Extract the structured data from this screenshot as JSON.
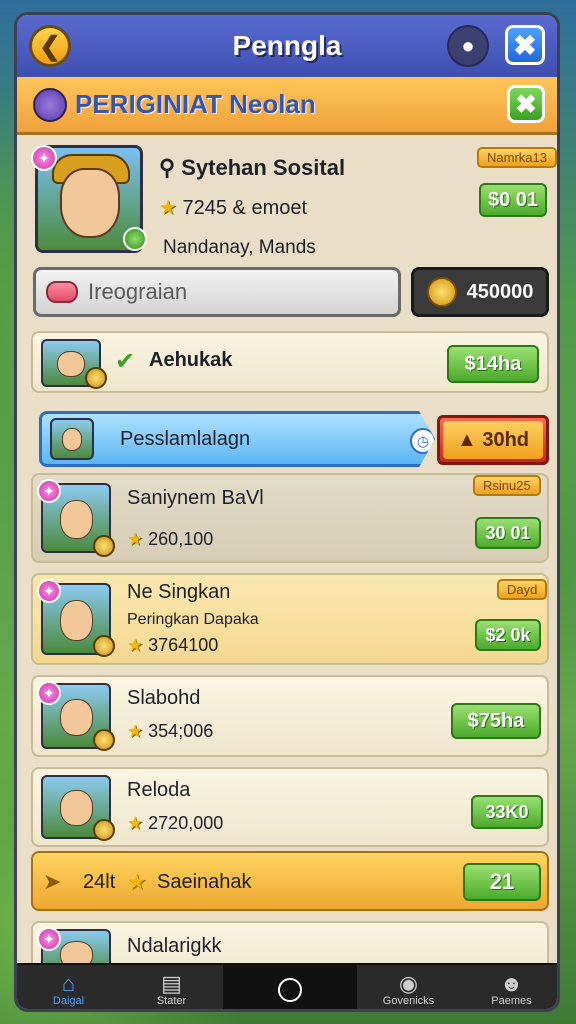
{
  "header": {
    "title": "Penngla",
    "back_icon": "chevron-left-icon",
    "close_icon": "close-icon"
  },
  "banner": {
    "title": "PERIGINIAT Neolan"
  },
  "profile": {
    "name": "Sytehan Sosital",
    "stars_text": "7245 & emoet",
    "subtitle": "Nandanay, Mands",
    "tag": "Namrka13",
    "price": "$0 01"
  },
  "search": {
    "placeholder": "Ireograian"
  },
  "coins": {
    "value": "450000"
  },
  "rows": [
    {
      "name": "Aehukak",
      "price": "$14ha"
    },
    {
      "name": "Pesslamlalagn",
      "price": "30hd"
    },
    {
      "name": "Saniynem BaVl",
      "stars": "260,100",
      "tag": "Rsinu25",
      "price": "30 01"
    },
    {
      "name": "Ne Singkan",
      "sub": "Peringkan Dapaka",
      "stars": "3764100",
      "tag": "Dayd",
      "price": "$2 0k"
    },
    {
      "name": "Slabohd",
      "stars": "354;006",
      "price": "$75ha"
    },
    {
      "name": "Reloda",
      "stars": "2720,000",
      "price": "33K0"
    },
    {
      "left": "24lt",
      "name": "Saeinahak",
      "price": "21"
    },
    {
      "name": "Ndalarigkk"
    }
  ],
  "nav": [
    {
      "label": "Daigal"
    },
    {
      "label": "Stater"
    },
    {
      "label": "Govenicks"
    },
    {
      "label": "Paemes"
    }
  ],
  "colors": {
    "accent": "#3e4fb0",
    "price_green": "#4caa2c",
    "highlight_blue": "#5cb6f5"
  }
}
